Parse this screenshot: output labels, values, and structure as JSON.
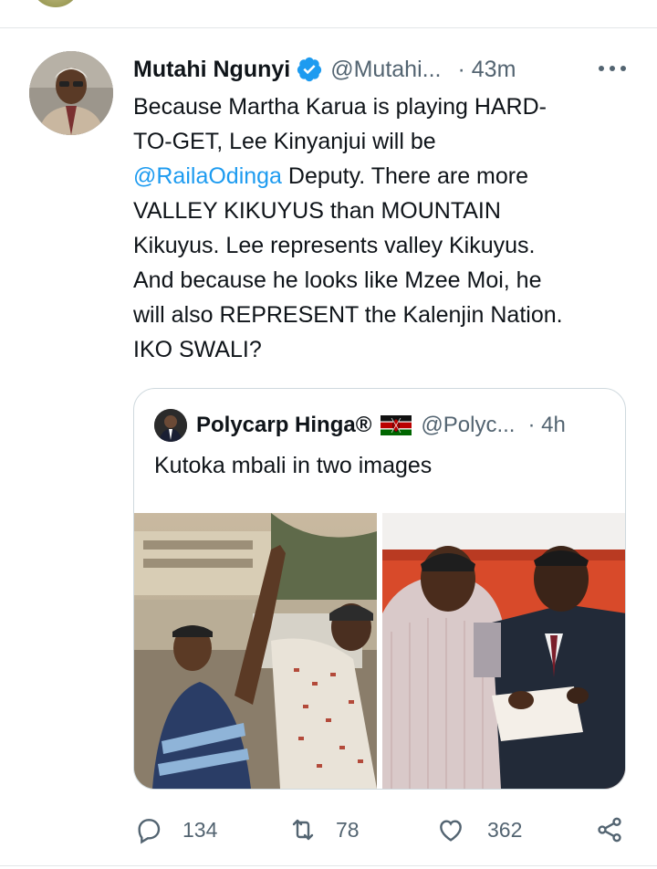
{
  "tweet": {
    "author_name": "Mutahi Ngunyi",
    "handle": "@Mutahi...",
    "time": "· 43m",
    "text_lines": [
      [
        "Because Martha Karua is playing HARD-"
      ],
      [
        "TO-GET, Lee Kinyanjui will be"
      ],
      [
        "@RailaOdinga",
        " Deputy. There are more"
      ],
      [
        "VALLEY KIKUYUS than MOUNTAIN"
      ],
      [
        "Kikuyus. Lee represents valley Kikuyus."
      ],
      [
        "And because he looks like Mzee Moi, he"
      ],
      [
        "will also REPRESENT the Kalenjin Nation."
      ],
      [
        "IKO SWALI?"
      ]
    ],
    "mention": "@RailaOdinga",
    "line3_rest": " Deputy. There are more"
  },
  "quote": {
    "author_name": "Polycarp Hinga®",
    "handle": "@Polyc...",
    "time": "· 4h",
    "text": "Kutoka mbali in two images"
  },
  "actions": {
    "replies": "134",
    "retweets": "78",
    "likes": "362"
  },
  "colors": {
    "accent": "#1d9bf0",
    "secondary_text": "#536471",
    "border": "#cfd9de"
  },
  "icons": [
    "verified-badge-icon",
    "more-icon",
    "reply-icon",
    "retweet-icon",
    "like-icon",
    "share-icon",
    "kenya-flag-icon"
  ]
}
